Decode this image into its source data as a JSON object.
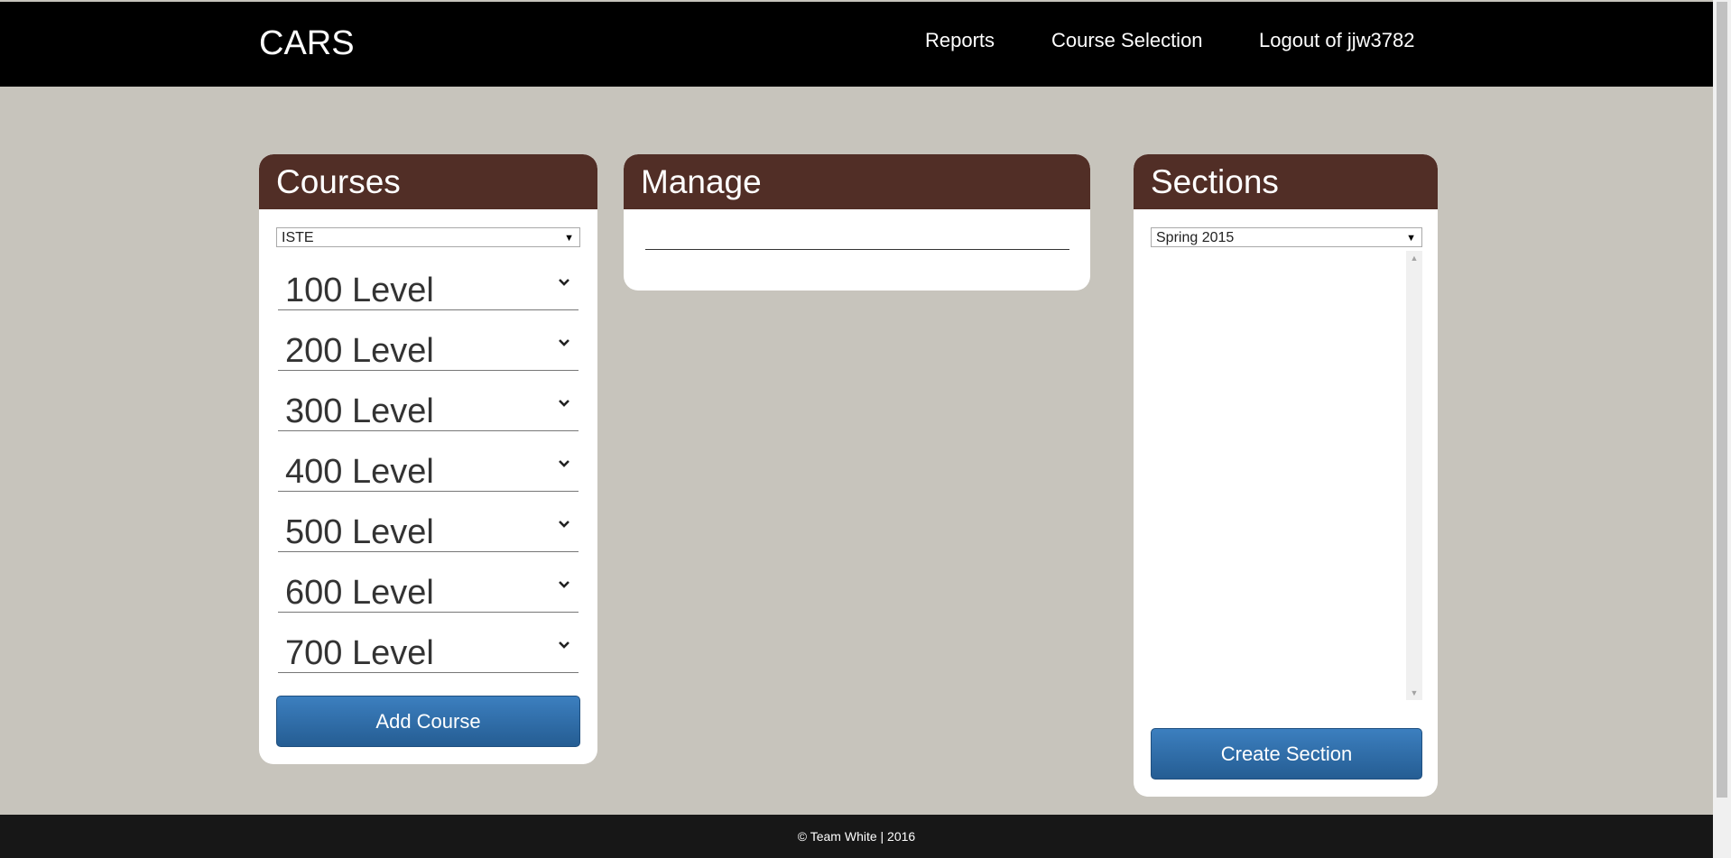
{
  "header": {
    "brand": "CARS",
    "nav": {
      "reports": "Reports",
      "course_selection": "Course Selection",
      "logout": "Logout of jjw3782"
    }
  },
  "courses": {
    "title": "Courses",
    "department_select": {
      "value": "ISTE",
      "options": [
        "ISTE"
      ]
    },
    "levels": [
      "100 Level",
      "200 Level",
      "300 Level",
      "400 Level",
      "500 Level",
      "600 Level",
      "700 Level"
    ],
    "add_button": "Add Course"
  },
  "manage": {
    "title": "Manage",
    "input_value": ""
  },
  "sections": {
    "title": "Sections",
    "term_select": {
      "value": "Spring 2015",
      "options": [
        "Spring 2015"
      ]
    },
    "list_items": [],
    "create_button": "Create Section"
  },
  "footer": {
    "text": "© Team White | 2016"
  },
  "colors": {
    "header_bg": "#000000",
    "page_bg": "#c7c4bc",
    "panel_head": "#512e26",
    "button": "#2d6aa6",
    "footer_bg": "#171717"
  },
  "icons": {
    "chevron": "chevron-down-icon",
    "select_caret": "caret-down-icon"
  }
}
